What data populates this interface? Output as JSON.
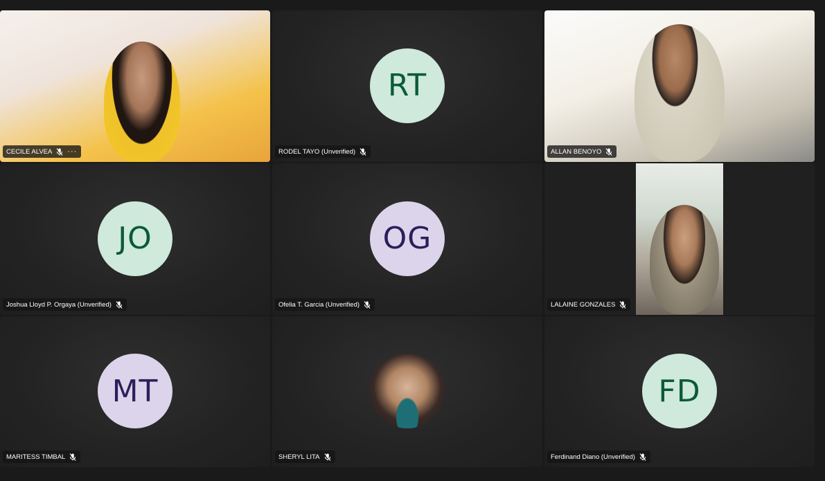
{
  "participants": [
    {
      "name": "CECILE ALVEA",
      "initials": "",
      "type": "video",
      "muted": true,
      "more": "···"
    },
    {
      "name": "RODEL TAYO (Unverified)",
      "initials": "RT",
      "type": "avatar-green",
      "muted": true
    },
    {
      "name": "ALLAN BENOYO",
      "initials": "",
      "type": "video",
      "muted": true
    },
    {
      "name": "Joshua Lloyd P. Orgaya (Unverified)",
      "initials": "JO",
      "type": "avatar-green",
      "muted": true
    },
    {
      "name": "Ofelia T. Garcia (Unverified)",
      "initials": "OG",
      "type": "avatar-purple",
      "muted": true
    },
    {
      "name": "LALAINE GONZALES",
      "initials": "",
      "type": "video",
      "muted": true
    },
    {
      "name": "MARITESS TIMBAL",
      "initials": "MT",
      "type": "avatar-purple",
      "muted": true
    },
    {
      "name": "SHERYL LITA",
      "initials": "",
      "type": "avatar-photo",
      "muted": true
    },
    {
      "name": "Ferdinand Diano (Unverified)",
      "initials": "FD",
      "type": "avatar-green",
      "muted": true
    }
  ],
  "colors": {
    "background": "#1a1a1a",
    "avatar_green_bg": "#cfe9dc",
    "avatar_green_fg": "#0b5a37",
    "avatar_purple_bg": "#dcd4ea",
    "avatar_purple_fg": "#2b1e5c"
  },
  "icons": {
    "muted": "microphone-muted-icon",
    "more": "more-options-icon"
  }
}
